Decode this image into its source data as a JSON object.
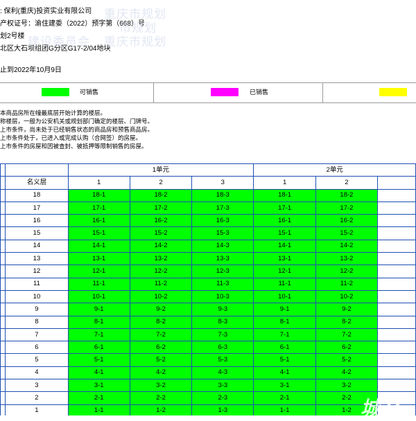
{
  "info": {
    "developer": ": 保利(重庆)投资实业有限公司",
    "permit": "产权证号：渝住建委（2022）预字第（668）号",
    "building": "划2号楼",
    "location": "北区大石坝组团G分区G17-2/04地块",
    "as_of": "止到2022年10月9日"
  },
  "watermarks": [
    "重庆市规划",
    "市规划",
    "建设委员会",
    "重庆市规划"
  ],
  "legend": [
    {
      "label": "可销售",
      "color": "#00ff00"
    },
    {
      "label": "已销售",
      "color": "#ff00ff"
    },
    {
      "label": "",
      "color": "#ffff00"
    }
  ],
  "notes": [
    "本商品房所在幢最底层开始计算的楼层。",
    "称楼层，一般为公安机关或规划部门确定的楼层、门牌号。",
    "上市条件，尚未处于已经销售状态的商品房和预售商品房。",
    "上市条件处于，已进入或完成认购（合网签）的房屋。",
    "上市条件的房屋和因被查封、被抵押等限制销售的房屋。"
  ],
  "table": {
    "units": [
      "1单元",
      "2单元"
    ],
    "floor_header": "名义层",
    "unit1_rooms": [
      "1",
      "2",
      "3"
    ],
    "unit2_rooms": [
      "1",
      "2"
    ],
    "rows": [
      {
        "floor": "18",
        "cells": [
          "18-1",
          "18-2",
          "18-3",
          "18-1",
          "18-2"
        ]
      },
      {
        "floor": "17",
        "cells": [
          "17-1",
          "17-2",
          "17-3",
          "17-1",
          "17-2"
        ]
      },
      {
        "floor": "16",
        "cells": [
          "16-1",
          "16-2",
          "16-3",
          "16-1",
          "16-2"
        ]
      },
      {
        "floor": "15",
        "cells": [
          "15-1",
          "15-2",
          "15-3",
          "15-1",
          "15-2"
        ]
      },
      {
        "floor": "14",
        "cells": [
          "14-1",
          "14-2",
          "14-3",
          "14-1",
          "14-2"
        ]
      },
      {
        "floor": "13",
        "cells": [
          "13-1",
          "13-2",
          "13-3",
          "13-1",
          "13-2"
        ]
      },
      {
        "floor": "12",
        "cells": [
          "12-1",
          "12-2",
          "12-3",
          "12-1",
          "12-2"
        ]
      },
      {
        "floor": "11",
        "cells": [
          "11-1",
          "11-2",
          "11-3",
          "11-1",
          "11-2"
        ]
      },
      {
        "floor": "10",
        "cells": [
          "10-1",
          "10-2",
          "10-3",
          "10-1",
          "10-2"
        ]
      },
      {
        "floor": "9",
        "cells": [
          "9-1",
          "9-2",
          "9-3",
          "9-1",
          "9-2"
        ]
      },
      {
        "floor": "8",
        "cells": [
          "8-1",
          "8-2",
          "8-3",
          "8-1",
          "8-2"
        ]
      },
      {
        "floor": "7",
        "cells": [
          "7-1",
          "7-2",
          "7-3",
          "7-1",
          "7-2"
        ]
      },
      {
        "floor": "6",
        "cells": [
          "6-1",
          "6-2",
          "6-3",
          "6-1",
          "6-2"
        ]
      },
      {
        "floor": "5",
        "cells": [
          "5-1",
          "5-2",
          "5-3",
          "5-1",
          "5-2"
        ]
      },
      {
        "floor": "4",
        "cells": [
          "4-1",
          "4-2",
          "4-3",
          "4-1",
          "4-2"
        ]
      },
      {
        "floor": "3",
        "cells": [
          "3-1",
          "3-2",
          "3-3",
          "3-1",
          "3-2"
        ]
      },
      {
        "floor": "2",
        "cells": [
          "2-1",
          "2-2",
          "2-3",
          "2-1",
          "2-2"
        ]
      },
      {
        "floor": "1",
        "cells": [
          "1-1",
          "1-2",
          "1-3",
          "1-1",
          "1-2"
        ]
      }
    ]
  },
  "logo_text": "城林"
}
